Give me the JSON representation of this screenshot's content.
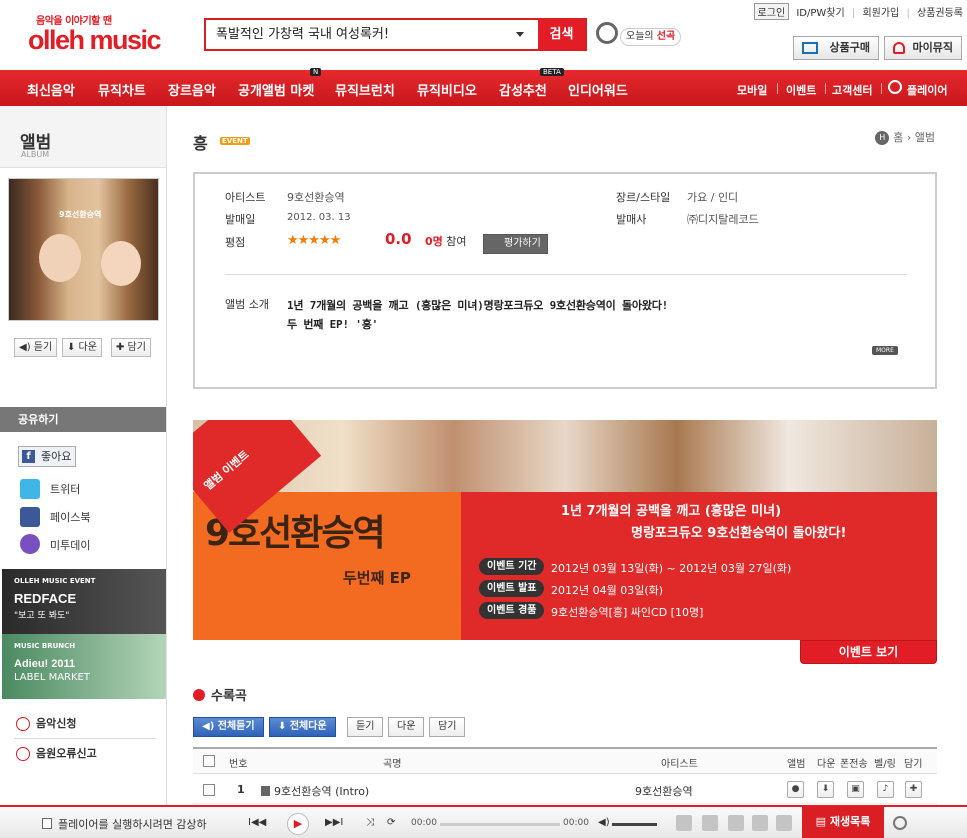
{
  "header": {
    "logo_tagline": "음악을 이야기할 땐",
    "logo": "olleh music",
    "search_value": "폭발적인 가창력 국내 여성록커!",
    "search_button": "검색",
    "today_pick_prefix": "오늘의 ",
    "today_pick_accent": "선곡",
    "top_links": [
      "로그인",
      "ID/PW찾기",
      "|",
      "회원가입",
      "|",
      "상품권등록"
    ],
    "buy_button": "상품구매",
    "my_button": "마이뮤직"
  },
  "nav": {
    "items": [
      "최신음악",
      "뮤직차트",
      "장르음악",
      "공개앨범 마켓",
      "뮤직브런치",
      "뮤직비디오",
      "감성추천",
      "인디어워드"
    ],
    "badge_n": "N",
    "badge_beta": "BETA",
    "right_items": [
      "모바일",
      "이벤트",
      "고객센터",
      "플레이어"
    ]
  },
  "sidebar": {
    "title": "앨범",
    "subtitle": "ALBUM",
    "cover_text": "9호선환승역",
    "buttons": [
      "◀) 듣기",
      "⬇ 다운",
      "✚ 담기"
    ],
    "share_title": "공유하기",
    "like": "좋아요",
    "sns": [
      "트위터",
      "페이스북",
      "미투데이"
    ],
    "ad1": {
      "small": "OLLEH MUSIC EVENT",
      "big": "REDFACE",
      "sub": "\"보고 또 봐도\""
    },
    "ad2": {
      "small": "MUSIC BRUNCH",
      "big": "Adieu! 2011",
      "sub": "LABEL MARKET"
    },
    "links": [
      "음악신청",
      "음원오류신고"
    ]
  },
  "main": {
    "title": "흥",
    "event_tag": "EVENT",
    "breadcrumb_home": "홈",
    "breadcrumb_sep": "›",
    "breadcrumb_current": "앨범",
    "info": {
      "artist_label": "아티스트",
      "artist": "9호선환승역",
      "release_label": "발매일",
      "release": "2012. 03. 13",
      "rating_label": "평점",
      "stars": "★★★★★",
      "score": "0.0",
      "votes_count": "0명",
      "votes_suffix": " 참여",
      "rate_button": "평가하기",
      "genre_label": "장르/스타일",
      "genre": "가요 / 인디",
      "label_label": "발매사",
      "label": "㈜디지탈레코드",
      "intro_label": "앨범 소개",
      "intro_line1": "1년 7개월의 공백을 깨고 (흥많은 미녀)명랑포크듀오 9호선환승역이 돌아왔다!",
      "intro_line2": "두 번째 EP! '흥'",
      "more": "MORE"
    },
    "banner": {
      "corner": "앨범 이벤트",
      "title": "9호선환승역",
      "subtitle": "두번째 EP",
      "headline1": "1년 7개월의 공백을 깨고 (흥많은 미녀)",
      "headline2": "명랑포크듀오 9호선환승역이 돌아왔다!",
      "rows": [
        {
          "label": "이벤트 기간",
          "value": "2012년 03월 13일(화) ~ 2012년 03월 27일(화)"
        },
        {
          "label": "이벤트 발표",
          "value": "2012년 04월 03일(화)"
        },
        {
          "label": "이벤트 경품",
          "value": "9호선환승역[흥] 싸인CD [10명]"
        }
      ],
      "view_button": "이벤트 보기"
    },
    "tracks": {
      "title": "수록곡",
      "buttons": [
        "◀) 전체듣기",
        "⬇ 전체다운",
        "듣기",
        "다운",
        "담기"
      ],
      "headers": [
        "번호",
        "곡명",
        "아티스트",
        "앨범",
        "다운",
        "폰전송",
        "벨/링",
        "담기"
      ],
      "rows": [
        {
          "no": "1",
          "title": "9호선환승역 (Intro)",
          "artist": "9호선환승역"
        }
      ]
    }
  },
  "player": {
    "message": "플레이어를 실행하시려면 감상하",
    "prev": "I◀◀",
    "play": "▶",
    "next": "▶▶I",
    "time_start": "00:00",
    "time_end": "00:00",
    "playlist": "재생목록"
  },
  "colors": {
    "brand_red": "#e31d25",
    "nav_red": "#d6181e",
    "button_blue": "#2f63b8"
  }
}
